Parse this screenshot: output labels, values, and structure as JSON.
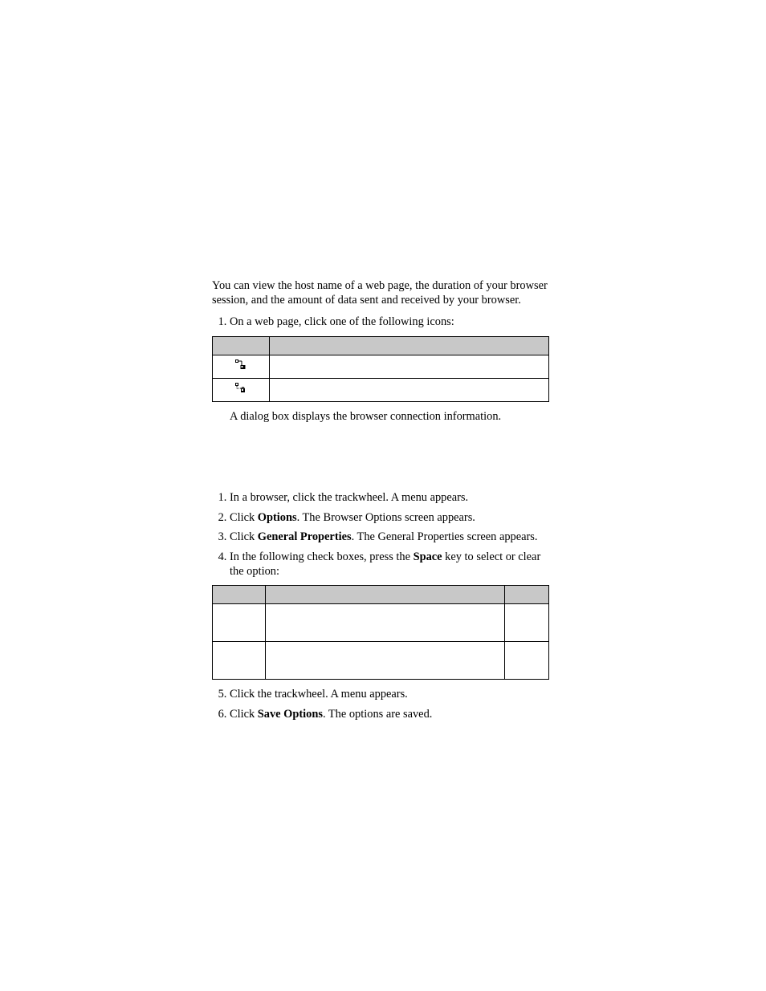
{
  "section1": {
    "intro": "You can view the host name of a web page, the duration of your browser session, and the amount of data sent and received by your browser.",
    "step1": "On a web page, click one of the following icons:",
    "dialog_line": "A dialog box displays the browser connection information.",
    "table": {
      "icon1_alt": "connected-icon",
      "icon2_alt": "connected-secure-icon"
    }
  },
  "section2": {
    "step1": "In a browser, click the trackwheel. A menu appears.",
    "step2a": "Click ",
    "step2b": "Options",
    "step2c": ". The Browser Options screen appears.",
    "step3a": "Click ",
    "step3b": "General Properties",
    "step3c": ". The General Properties screen appears.",
    "step4a": "In the following check boxes, press the ",
    "step4b": "Space",
    "step4c": " key to select or clear the option:",
    "step5": "Click the trackwheel. A menu appears.",
    "step6a": "Click ",
    "step6b": "Save Options",
    "step6c": ". The options are saved."
  }
}
